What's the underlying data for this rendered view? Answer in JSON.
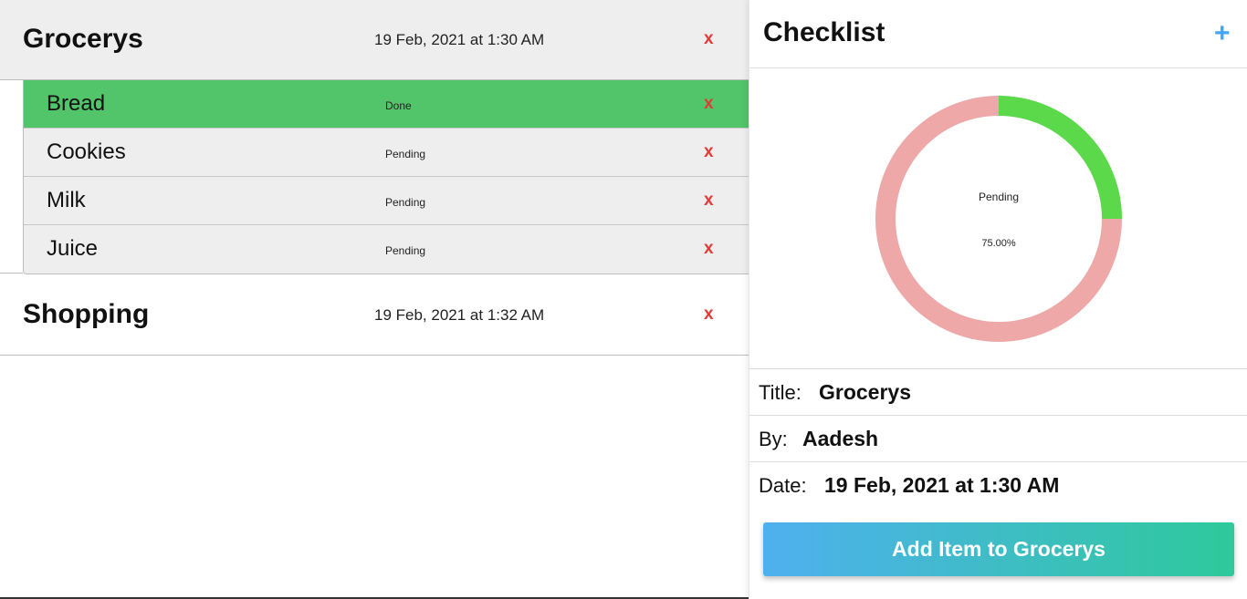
{
  "lists": [
    {
      "title": "Grocerys",
      "date": "19 Feb, 2021 at 1:30 AM",
      "delete_label": "x",
      "items": [
        {
          "name": "Bread",
          "status": "Done",
          "delete_label": "x"
        },
        {
          "name": "Cookies",
          "status": "Pending",
          "delete_label": "x"
        },
        {
          "name": "Milk",
          "status": "Pending",
          "delete_label": "x"
        },
        {
          "name": "Juice",
          "status": "Pending",
          "delete_label": "x"
        }
      ]
    },
    {
      "title": "Shopping",
      "date": "19 Feb, 2021 at 1:32 AM",
      "delete_label": "x"
    }
  ],
  "panel": {
    "title": "Checklist",
    "add_icon": "+",
    "details": {
      "title_label": "Title:",
      "title_value": "Grocerys",
      "by_label": "By:",
      "by_value": "Aadesh",
      "date_label": "Date:",
      "date_value": "19 Feb, 2021 at 1:30 AM"
    },
    "add_button_label": "Add Item to Grocerys"
  },
  "chart_data": {
    "type": "pie",
    "categories": [
      "Done",
      "Pending"
    ],
    "values": [
      25,
      75
    ],
    "colors": [
      "#5cd94a",
      "#eea8a8"
    ],
    "center_label": "Pending",
    "center_value": "75.00%"
  },
  "colors": {
    "done_row": "#52c46a",
    "delete": "#e53935",
    "accent": "#42a5f5",
    "button_gradient_start": "#4fb0ef",
    "button_gradient_end": "#2ec99b"
  }
}
